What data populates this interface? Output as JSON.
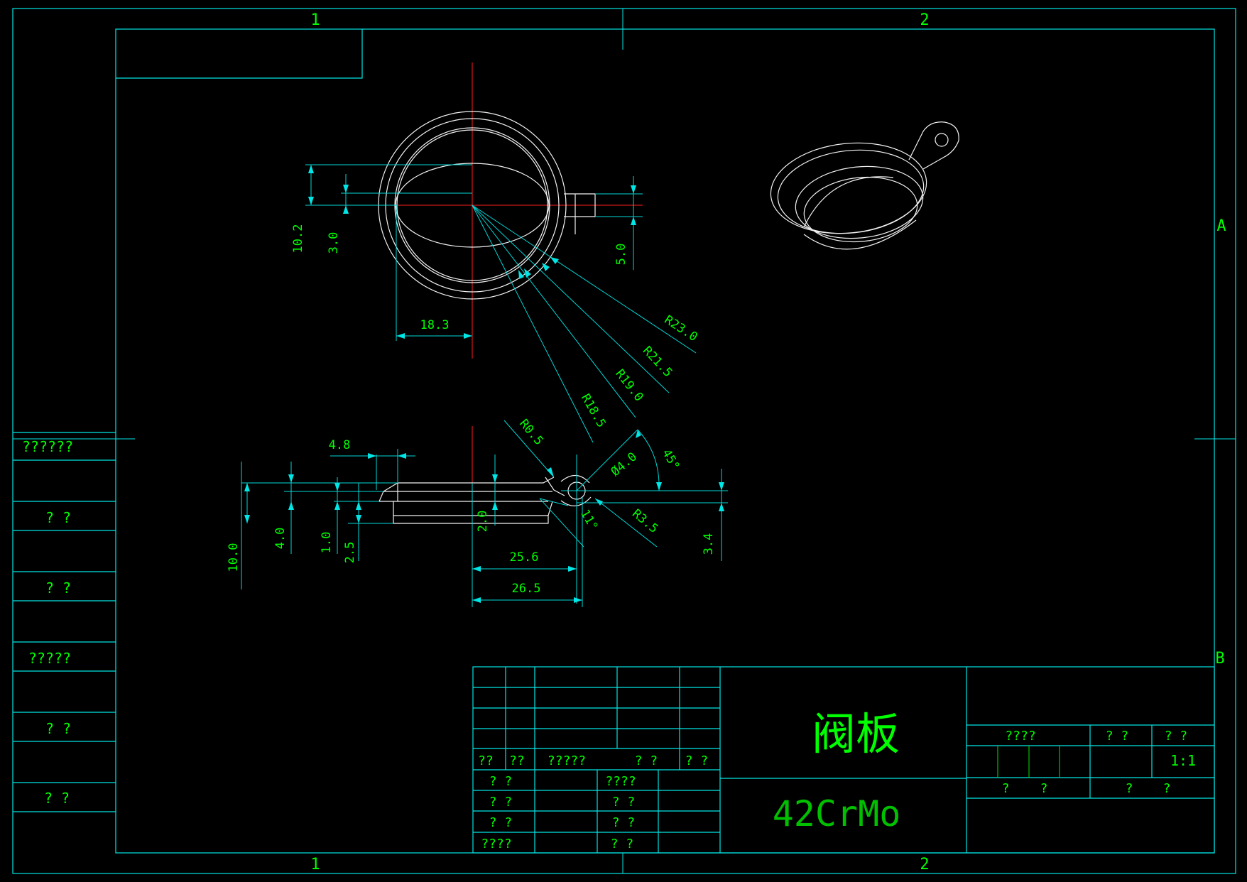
{
  "colors": {
    "background": "#000000",
    "frame": "#00e5e5",
    "text": "#00ff00",
    "geometry": "#f2f2f2",
    "centerline": "#ff2020"
  },
  "zones": {
    "col1": "1",
    "col2": "2",
    "rowA": "A",
    "rowB": "B"
  },
  "dimensions": {
    "d_10_2": "10.2",
    "d_3_0": "3.0",
    "d_5_0": "5.0",
    "d_18_3": "18.3",
    "r_23_0": "R23.0",
    "r_21_5": "R21.5",
    "r_19_0": "R19.0",
    "r_18_5": "R18.5",
    "r_0_5": "R0.5",
    "dia_4_0": "Ø4.0",
    "ang_45": "45°",
    "r_3_5": "R3.5",
    "ang_11": "11°",
    "d_4_8": "4.8",
    "d_2_0": "2.0",
    "d_25_6": "25.6",
    "d_26_5": "26.5",
    "d_3_4": "3.4",
    "d_10_0": "10.0",
    "d_4_0": "4.0",
    "d_1_0": "1.0",
    "d_2_5": "2.5"
  },
  "side_table": [
    "??????",
    "? ?",
    "? ?",
    "?????",
    "? ?",
    "? ?"
  ],
  "title_block": {
    "part_name": "阀板",
    "material": "42CrMo",
    "scale": "1:1",
    "left_row1": [
      "??",
      "??",
      "?????",
      "? ?",
      "? ?"
    ],
    "left_col_a": [
      "? ?",
      "? ?",
      "? ?",
      "????"
    ],
    "left_col_b": [
      "????",
      "? ?",
      "? ?",
      "? ?"
    ],
    "right_labels": [
      "????",
      "? ?",
      "? ?"
    ],
    "right_bottom": [
      "?",
      "?",
      "?",
      "?"
    ]
  }
}
